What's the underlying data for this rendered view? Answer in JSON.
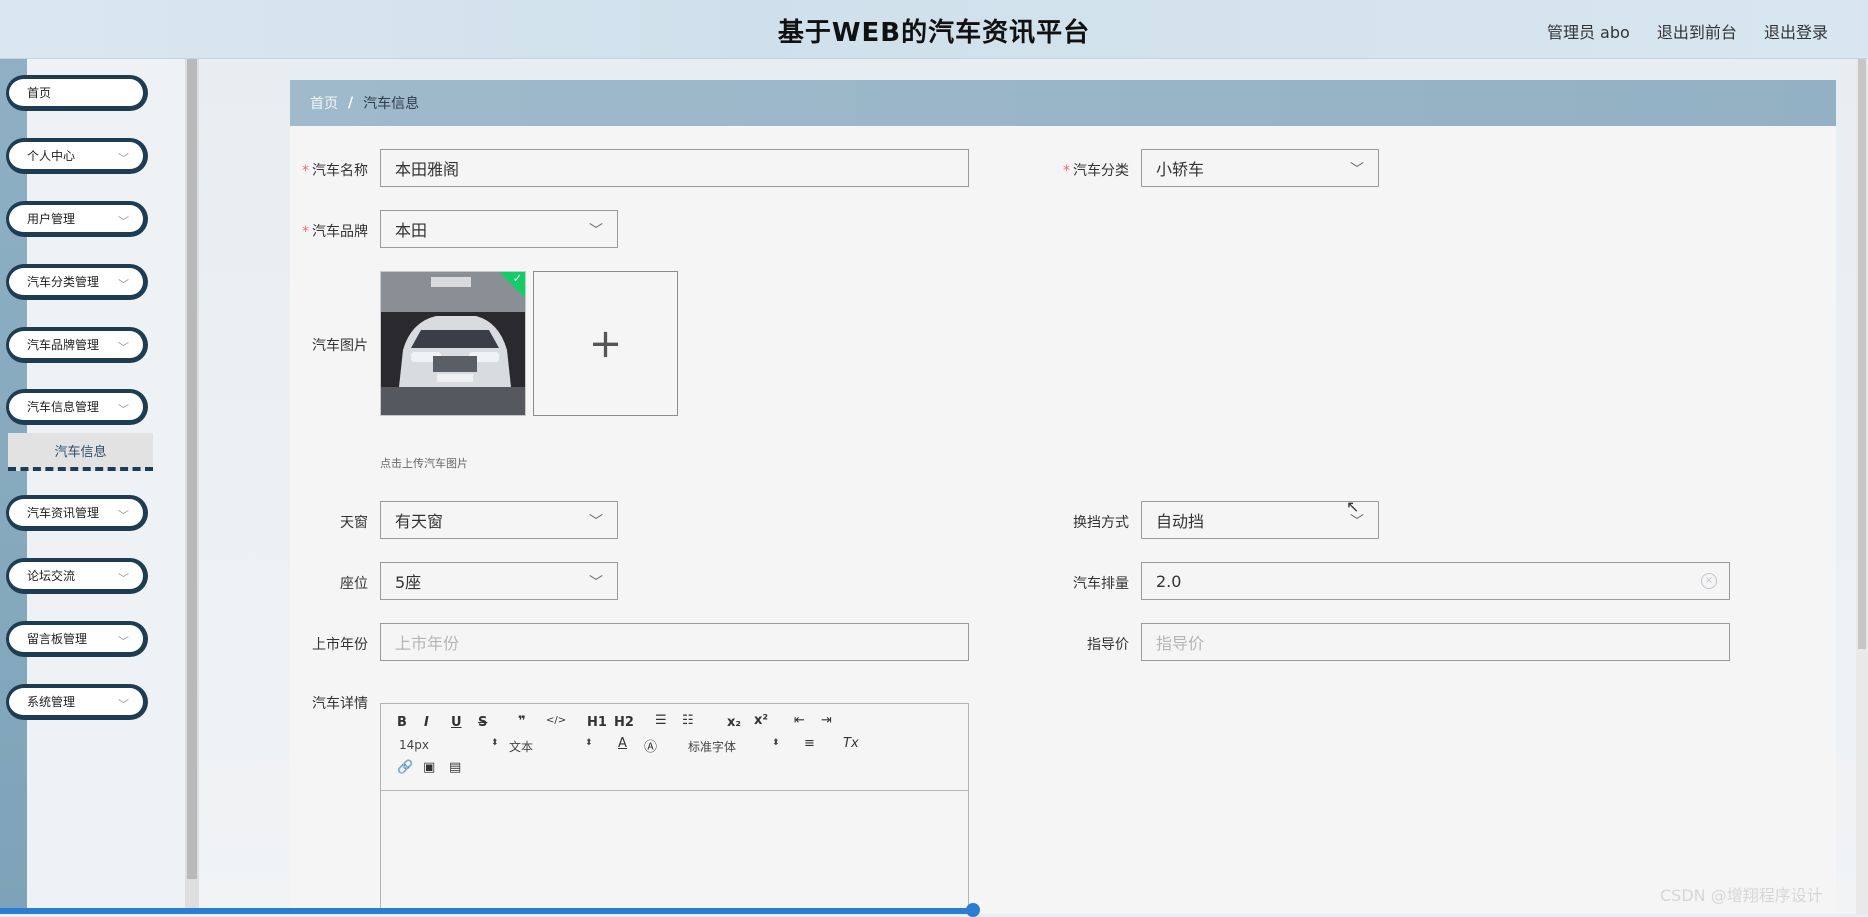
{
  "header": {
    "title": "基于WEB的汽车资讯平台",
    "user_label": "管理员 abo",
    "front_link": "退出到前台",
    "logout_link": "退出登录"
  },
  "sidebar": {
    "items": [
      {
        "label": "首页",
        "has_chevron": false
      },
      {
        "label": "个人中心",
        "has_chevron": true
      },
      {
        "label": "用户管理",
        "has_chevron": true
      },
      {
        "label": "汽车分类管理",
        "has_chevron": true
      },
      {
        "label": "汽车品牌管理",
        "has_chevron": true
      },
      {
        "label": "汽车信息管理",
        "has_chevron": true
      },
      {
        "label": "汽车资讯管理",
        "has_chevron": true
      },
      {
        "label": "论坛交流",
        "has_chevron": true
      },
      {
        "label": "留言板管理",
        "has_chevron": true
      },
      {
        "label": "系统管理",
        "has_chevron": true
      }
    ],
    "active_subitem": "汽车信息"
  },
  "breadcrumb": {
    "home": "首页",
    "separator": "/",
    "current": "汽车信息"
  },
  "form": {
    "car_name": {
      "label": "汽车名称",
      "required": true,
      "value": "本田雅阁"
    },
    "car_category": {
      "label": "汽车分类",
      "required": true,
      "value": "小轿车"
    },
    "car_brand": {
      "label": "汽车品牌",
      "required": true,
      "value": "本田"
    },
    "car_image": {
      "label": "汽车图片",
      "tip": "点击上传汽车图片"
    },
    "sunroof": {
      "label": "天窗",
      "value": "有天窗"
    },
    "transmission": {
      "label": "换挡方式",
      "value": "自动挡"
    },
    "seats": {
      "label": "座位",
      "value": "5座"
    },
    "displacement": {
      "label": "汽车排量",
      "value": "2.0"
    },
    "release_year": {
      "label": "上市年份",
      "placeholder": "上市年份"
    },
    "guide_price": {
      "label": "指导价",
      "placeholder": "指导价"
    },
    "details": {
      "label": "汽车详情"
    }
  },
  "editor": {
    "font_size": "14px",
    "text_type": "文本",
    "font_family": "标准字体",
    "buttons": [
      "B",
      "I",
      "U",
      "S",
      "❞",
      "</>",
      "H1",
      "H2",
      "ordered-list",
      "bullet-list",
      "subscript",
      "superscript",
      "outdent",
      "indent"
    ]
  },
  "watermark": "CSDN @增翔程序设计",
  "colors": {
    "sidebar_border": "#1e3d52",
    "breadcrumb_bg": "#9fbacb",
    "required_star": "#f56c6c",
    "success_badge": "#13ce66"
  }
}
